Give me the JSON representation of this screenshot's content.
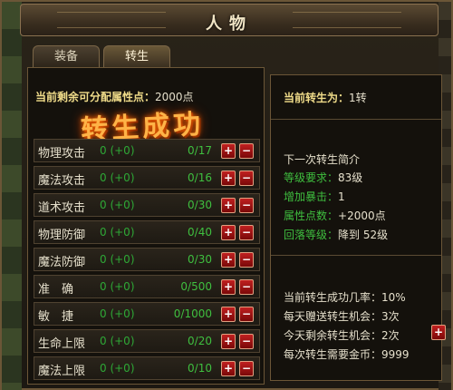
{
  "window": {
    "title": "人物"
  },
  "tabs": [
    {
      "label": "装备",
      "active": false
    },
    {
      "label": "转生",
      "active": true
    }
  ],
  "points": {
    "label": "当前剩余可分配属性点：",
    "value": "2000点"
  },
  "banner": "转生成功",
  "stats": [
    {
      "name": "物理攻击",
      "value": "0 (+0)",
      "progress": "0/17"
    },
    {
      "name": "魔法攻击",
      "value": "0 (+0)",
      "progress": "0/16"
    },
    {
      "name": "道术攻击",
      "value": "0 (+0)",
      "progress": "0/30"
    },
    {
      "name": "物理防御",
      "value": "0 (+0)",
      "progress": "0/40"
    },
    {
      "name": "魔法防御",
      "value": "0 (+0)",
      "progress": "0/30"
    },
    {
      "name": "准　确",
      "value": "0 (+0)",
      "progress": "0/500"
    },
    {
      "name": "敏　捷",
      "value": "0 (+0)",
      "progress": "0/1000"
    },
    {
      "name": "生命上限",
      "value": "0 (+0)",
      "progress": "0/20"
    },
    {
      "name": "魔法上限",
      "value": "0 (+0)",
      "progress": "0/10"
    }
  ],
  "buttons": {
    "plus": "+",
    "minus": "−"
  },
  "rebirth": {
    "current_label": "当前转生为：",
    "current_value": "1转",
    "next_title": "下一次转生简介",
    "level_req_label": "等级要求：",
    "level_req_value": "83级",
    "crit_label": "增加暴击：",
    "crit_value": "1",
    "attr_label": "属性点数：",
    "attr_value": "+2000点",
    "fall_label": "回落等级：",
    "fall_value": "降到 52级",
    "rate_label": "当前转生成功几率：",
    "rate_value": "10%",
    "daily_gift_label": "每天赠送转生机会：",
    "daily_gift_value": "3次",
    "remaining_label": "今天剩余转生机会：",
    "remaining_value": "2次",
    "gold_label": "每次转生需要金币：",
    "gold_value": "9999"
  },
  "colors": {
    "accent_gold": "#f0dc8a",
    "green": "#3fbf3f",
    "button_red": "#c02020",
    "banner_orange": "#ffb347"
  }
}
